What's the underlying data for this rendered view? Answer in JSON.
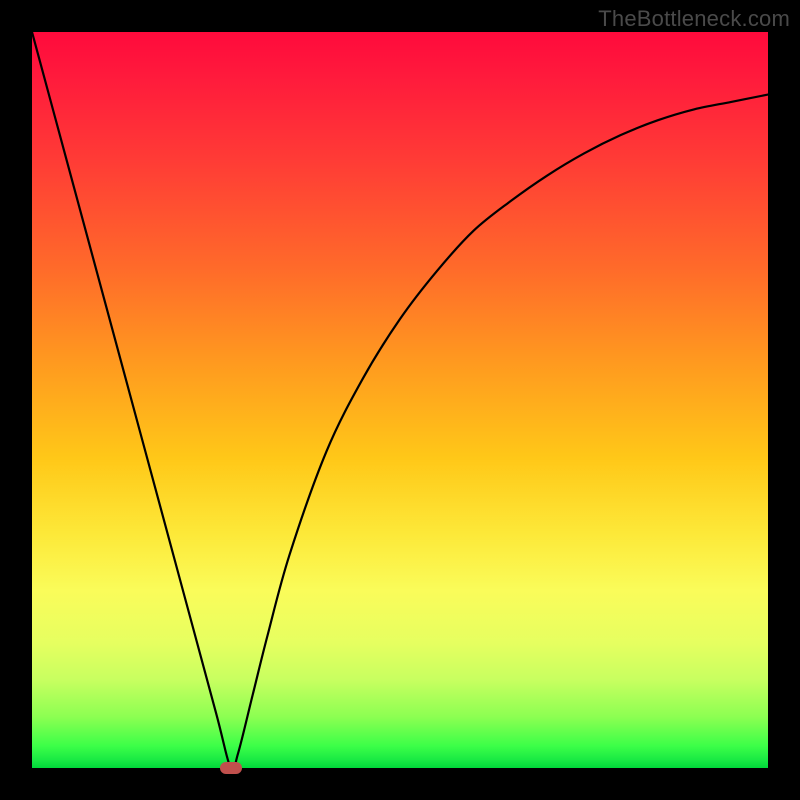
{
  "watermark": "TheBottleneck.com",
  "chart_data": {
    "type": "line",
    "title": "",
    "xlabel": "",
    "ylabel": "",
    "xlim": [
      0,
      1
    ],
    "ylim": [
      0,
      1
    ],
    "grid": false,
    "series": [
      {
        "name": "curve",
        "x": [
          0.0,
          0.05,
          0.1,
          0.15,
          0.2,
          0.25,
          0.27,
          0.28,
          0.3,
          0.32,
          0.35,
          0.4,
          0.45,
          0.5,
          0.55,
          0.6,
          0.65,
          0.7,
          0.75,
          0.8,
          0.85,
          0.9,
          0.95,
          1.0
        ],
        "y": [
          1.0,
          0.815,
          0.63,
          0.445,
          0.26,
          0.075,
          0.0,
          0.02,
          0.1,
          0.18,
          0.29,
          0.43,
          0.53,
          0.61,
          0.675,
          0.73,
          0.77,
          0.805,
          0.835,
          0.86,
          0.88,
          0.895,
          0.905,
          0.915
        ]
      }
    ],
    "marker": {
      "x": 0.27,
      "y": 0.0,
      "color": "#c0504d"
    },
    "background_gradient": {
      "top": "#ff0a3c",
      "bottom": "#00d83a"
    }
  }
}
